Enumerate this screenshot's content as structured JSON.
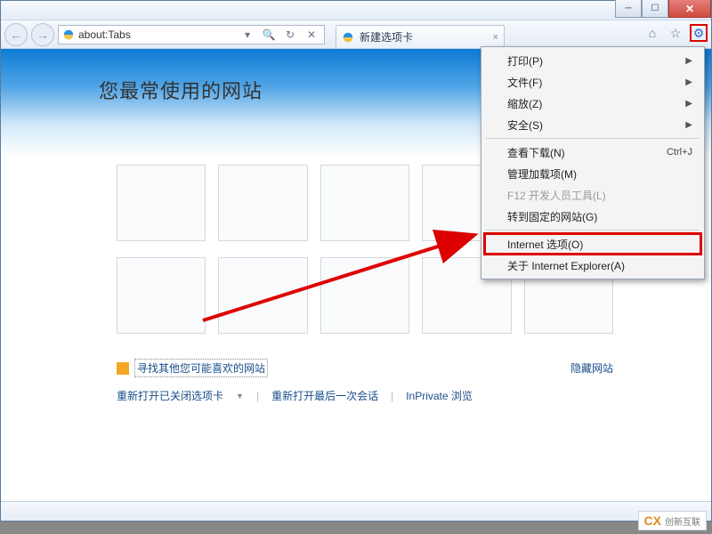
{
  "window": {
    "min_label": "─",
    "max_label": "☐",
    "close_label": "✕"
  },
  "nav": {
    "back_glyph": "←",
    "forward_glyph": "→",
    "address_value": "about:Tabs",
    "search_glyph": "🔍",
    "dropdown_glyph": "▾",
    "refresh_glyph": "↻",
    "stop_glyph": "✕"
  },
  "tab": {
    "title": "新建选项卡",
    "close_glyph": "×"
  },
  "toolbar_icons": {
    "home_glyph": "⌂",
    "star_glyph": "☆",
    "gear_glyph": "⚙"
  },
  "hero": {
    "title": "您最常使用的网站"
  },
  "discover": {
    "link_text": "寻找其他您可能喜欢的网站",
    "hide_text": "隐藏网站"
  },
  "actions": {
    "reopen_closed": "重新打开已关闭选项卡",
    "reopen_last": "重新打开最后一次会话",
    "inprivate": "InPrivate 浏览"
  },
  "menu": {
    "items": [
      {
        "label": "打印(P)",
        "submenu": true
      },
      {
        "label": "文件(F)",
        "submenu": true
      },
      {
        "label": "缩放(Z)",
        "submenu": true
      },
      {
        "label": "安全(S)",
        "submenu": true
      }
    ],
    "sep1": true,
    "items2": [
      {
        "label": "查看下载(N)",
        "shortcut": "Ctrl+J"
      },
      {
        "label": "管理加载项(M)"
      },
      {
        "label": "F12 开发人员工具(L)",
        "disabled": true
      },
      {
        "label": "转到固定的网站(G)"
      }
    ],
    "sep2": true,
    "items3": [
      {
        "label": "Internet 选项(O)",
        "highlight": true
      },
      {
        "label": "关于 Internet Explorer(A)"
      }
    ]
  },
  "watermark": {
    "logo": "CX",
    "text": "创新互联"
  }
}
